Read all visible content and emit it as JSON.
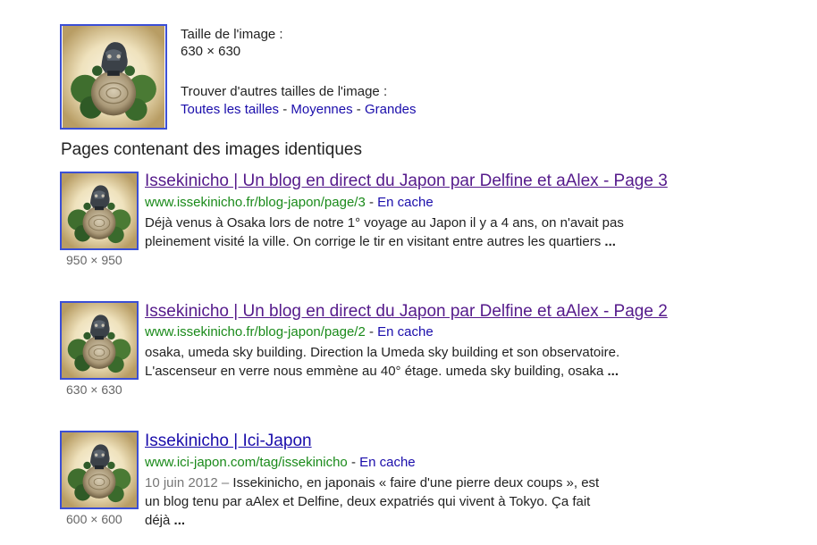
{
  "main_image": {
    "size_heading": "Taille de l'image :",
    "size_value": "630 × 630",
    "other_sizes_heading": "Trouver d'autres tailles de l'image :",
    "links": [
      "Toutes les tailles",
      "Moyennes",
      "Grandes"
    ],
    "separator": "-"
  },
  "section_title": "Pages contenant des images identiques",
  "results": [
    {
      "title": "Issekinicho | Un blog en direct du Japon par Delfine et aAlex - Page 3",
      "url": "www.issekinicho.fr/blog-japon/page/3",
      "url_separator": "-",
      "cache_label": "En cache",
      "date": "",
      "snippet_line1": "Déjà venus à Osaka lors de notre 1° voyage au Japon il y a 4 ans, on n'avait pas",
      "snippet_line2": "pleinement visité la ville. On corrige le tir en visitant entre autres les quartiers",
      "ellipsis": "...",
      "image_size": "950 × 950"
    },
    {
      "title": "Issekinicho | Un blog en direct du Japon par Delfine et aAlex - Page 2",
      "url": "www.issekinicho.fr/blog-japon/page/2",
      "url_separator": "-",
      "cache_label": "En cache",
      "date": "",
      "snippet_line1": "osaka, umeda sky building. Direction la Umeda sky building et son observatoire.",
      "snippet_line2": "L'ascenseur en verre nous emmène au 40° étage. umeda sky building, osaka",
      "ellipsis": "...",
      "image_size": "630 × 630"
    },
    {
      "title": "Issekinicho | Ici-Japon",
      "url": "www.ici-japon.com/tag/issekinicho",
      "url_separator": "-",
      "cache_label": "En cache",
      "date": "10 juin 2012 –",
      "snippet_line1": " Issekinicho, en japonais « faire d'une pierre deux coups », est",
      "snippet_line2": "un blog tenu par aAlex et Delfine, deux expatriés qui vivent à Tokyo. Ça fait",
      "snippet_line3": "déjà",
      "ellipsis": "...",
      "image_size": "600 × 600"
    }
  ],
  "colors": {
    "link": "#1a0dab",
    "visited": "#551a8b",
    "url": "#1a8a1a",
    "thumb_border": "#3b4fd6"
  },
  "icons": [
    "planet-photo-thumbnail"
  ]
}
